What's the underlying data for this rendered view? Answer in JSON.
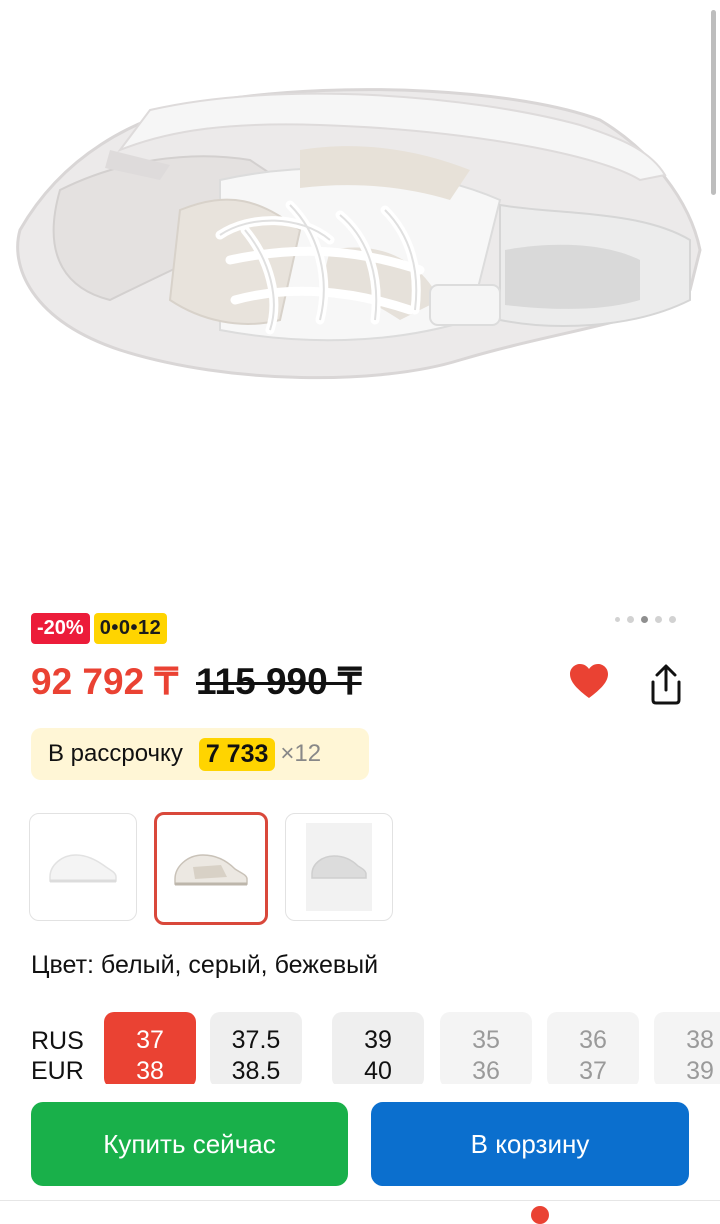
{
  "product": {
    "badges": {
      "discount": "-20%",
      "timer": "0•0•12"
    },
    "price": {
      "current": "92 792 ₸",
      "old": "115 990 ₸"
    },
    "installment": {
      "label": "В рассрочку",
      "amount": "7 733",
      "multiplier": "×12"
    },
    "color_label": "Цвет: белый, серый, бежевый",
    "gallery": {
      "count": 5,
      "active_index": 2
    },
    "colors": {
      "accent": "#ea4233",
      "buy": "#19b04a",
      "cart": "#0b6fce",
      "badge_yellow": "#ffd400"
    }
  },
  "variants": [
    {
      "name": "white"
    },
    {
      "name": "white-grey-beige",
      "selected": true
    },
    {
      "name": "grey"
    }
  ],
  "sizes": {
    "systems": [
      "RUS",
      "EUR"
    ],
    "items": [
      {
        "rus": "37",
        "eur": "38",
        "state": "selected"
      },
      {
        "rus": "37.5",
        "eur": "38.5",
        "state": "available"
      },
      {
        "rus": "39",
        "eur": "40",
        "state": "available"
      },
      {
        "rus": "35",
        "eur": "36",
        "state": "unavailable"
      },
      {
        "rus": "36",
        "eur": "37",
        "state": "unavailable"
      },
      {
        "rus": "38",
        "eur": "39",
        "state": "unavailable"
      }
    ]
  },
  "actions": {
    "buy_now": "Купить сейчас",
    "add_to_cart": "В корзину"
  },
  "icons": {
    "favorite": "heart-icon",
    "share": "share-icon"
  }
}
